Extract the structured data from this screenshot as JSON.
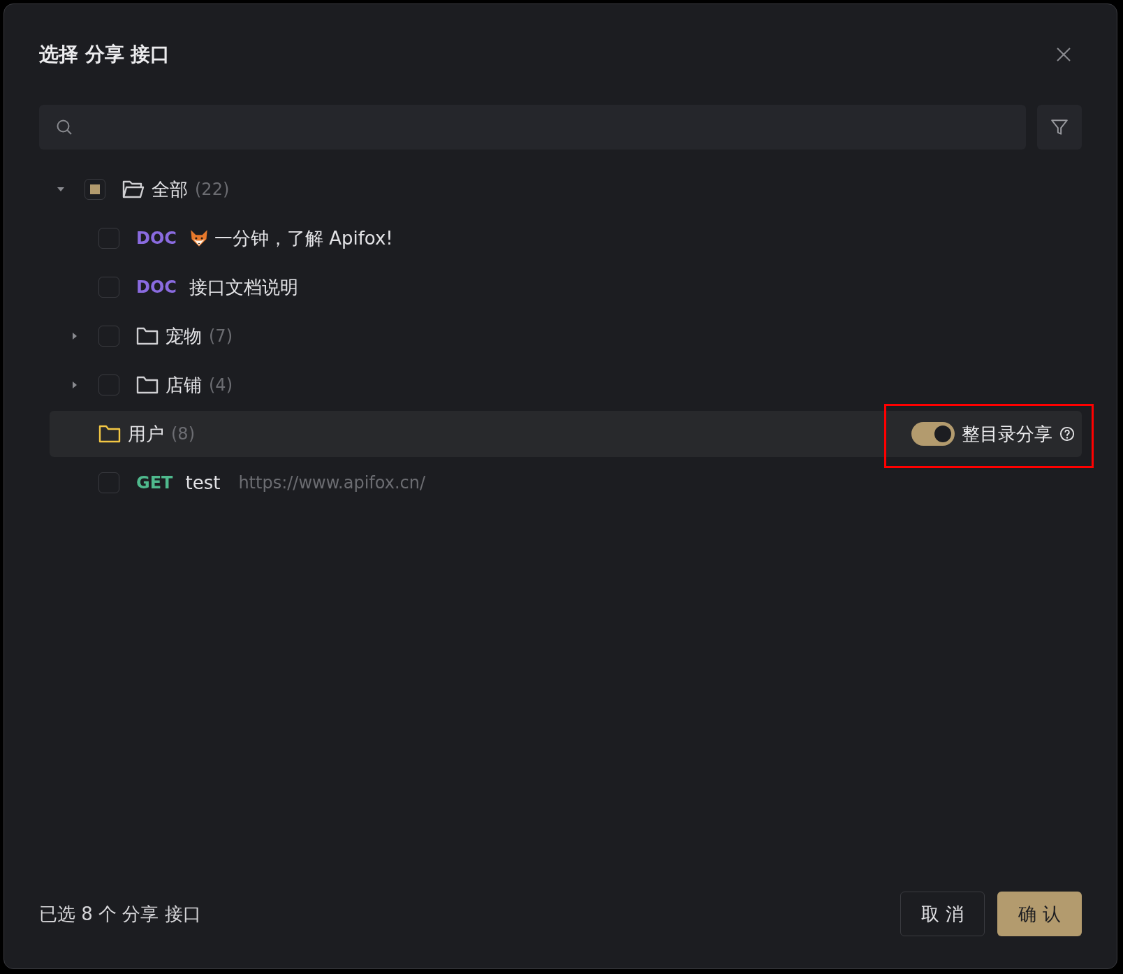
{
  "dialog": {
    "title": "选择 分享 接口"
  },
  "tree": [
    {
      "kind": "folder",
      "name": "全部",
      "count": "(22)",
      "expanded": true,
      "checked": false,
      "indeterminate": true,
      "highlighted": false,
      "children": [
        {
          "kind": "doc",
          "badge": "DOC",
          "emoji": true,
          "name": "一分钟，了解 Apifox!",
          "checked": false
        },
        {
          "kind": "doc",
          "badge": "DOC",
          "emoji": false,
          "name": "接口文档说明",
          "checked": false
        },
        {
          "kind": "folder",
          "name": "宠物",
          "count": "(7)",
          "expanded": false,
          "checked": false,
          "indeterminate": false,
          "highlighted": false
        },
        {
          "kind": "folder",
          "name": "店铺",
          "count": "(4)",
          "expanded": false,
          "checked": false,
          "indeterminate": false,
          "highlighted": false
        },
        {
          "kind": "folder",
          "name": "用户",
          "count": "(8)",
          "highlighted": true,
          "share_toggle": {
            "label": "整目录分享",
            "on": true
          }
        },
        {
          "kind": "api",
          "method": "GET",
          "name": "test",
          "url": "https://www.apifox.cn/",
          "checked": false
        }
      ]
    }
  ],
  "footer": {
    "summary": "已选 8 个 分享 接口",
    "buttons": [
      {
        "kind": "cancel",
        "label": "取 消"
      },
      {
        "kind": "confirm",
        "label": "确 认"
      }
    ]
  }
}
